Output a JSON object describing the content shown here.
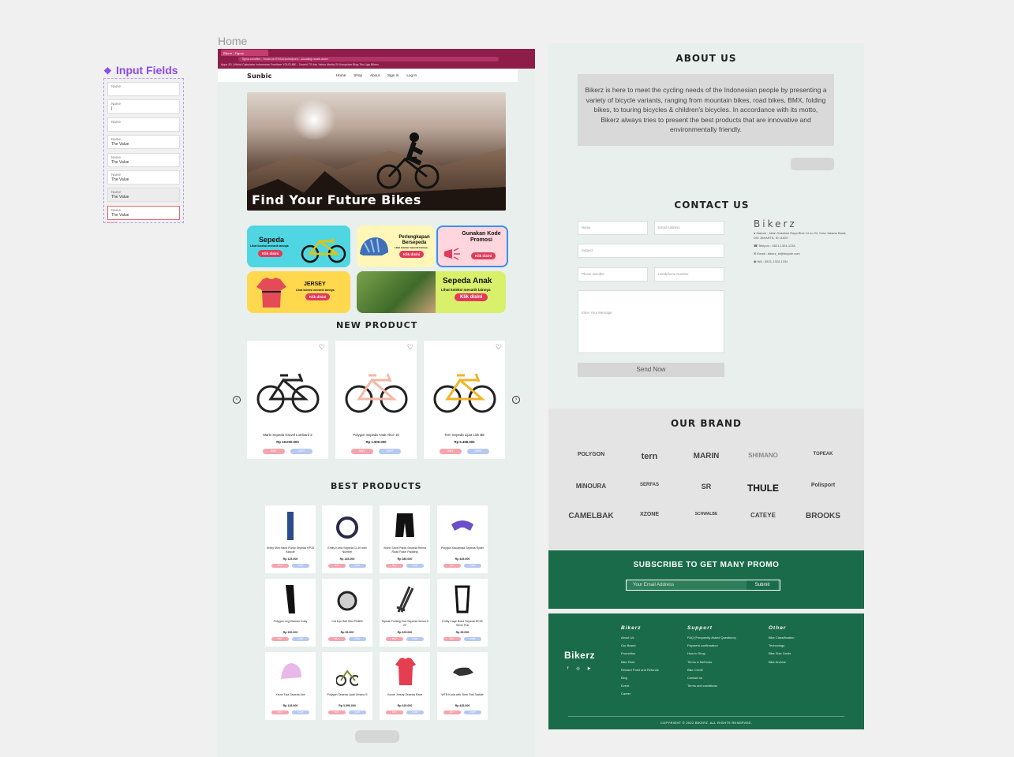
{
  "component_panel": {
    "title": "Input Fields",
    "fields": [
      {
        "label": "Name",
        "value": "",
        "state": "default"
      },
      {
        "label": "Name",
        "value": "|",
        "state": "focus"
      },
      {
        "label": "Name",
        "value": "",
        "state": "default"
      },
      {
        "label": "Name",
        "value": "The Value",
        "state": "filled"
      },
      {
        "label": "Name",
        "value": "The Value",
        "state": "filled"
      },
      {
        "label": "Name",
        "value": "The Value",
        "state": "filled"
      },
      {
        "label": "Name",
        "value": "The Value",
        "state": "disabled"
      },
      {
        "label": "Name",
        "value": "The Value",
        "state": "error"
      }
    ],
    "error_text": "Error text"
  },
  "home": {
    "frame_label": "Home",
    "browser": {
      "tab": "Bikerz - Figma",
      "url": "figma.com/file/...?node-id=0%3A1&viewport=...&scaling=scale-down",
      "bookmarks": "Apps   2D | Weird Calculator   Indonesian Furniture   YOUTUBE - Toweld   TS   Ask Yahoo   Media   20 Kumpulan Blog   Tim Liga Bikerz"
    },
    "nav": {
      "logo": "Sunbic",
      "links": [
        "Home",
        "Shop",
        "About",
        "Sign In",
        "Log In"
      ]
    },
    "hero_title": "Find Your Future Bikes",
    "categories": {
      "sepeda": {
        "title": "Sepeda",
        "sub": "Lihat koleksi menarik lainnya",
        "btn": "Klik disini"
      },
      "perlengkapan": {
        "title": "Perlengkapan Bersepeda",
        "sub": "Lihat koleksi menarik lainnya",
        "btn": "Klik disini"
      },
      "kode": {
        "title": "Gunakan Kode Promosi",
        "btn": "Klik disini"
      },
      "jersey": {
        "title": "JERSEY",
        "sub": "Lihat koleksi menarik lainnya",
        "btn": "Klik disini"
      },
      "anak": {
        "title": "Sepeda Anak",
        "sub": "Lihat koleksi menarik lainnya",
        "btn": "Klik disini"
      }
    },
    "new_product_title": "NEW PRODUCT",
    "new_products": [
      {
        "name": "Marin Sepeda Gravel Lombard 2",
        "price": "Rp 19.000.000",
        "buy": "BUY",
        "cart": "CART"
      },
      {
        "name": "Polygon Sepeda Anak Alice 16",
        "price": "Rp 1.900.000",
        "buy": "BUY",
        "cart": "CART"
      },
      {
        "name": "Tern Sepeda Lipat Link B8",
        "price": "Rp 5.458.000",
        "buy": "BUY",
        "cart": "CART"
      }
    ],
    "best_products_title": "BEST PRODUCTS",
    "best_products": [
      {
        "name": "Entity Mini Hand Pump Sepeda HP15 Bicycle",
        "price": "Rp 125.000",
        "buy": "BUY",
        "cart": "CART"
      },
      {
        "name": "Entity Kunci Sepeda CL30 with Number",
        "price": "Rp 145.000",
        "buy": "BUY",
        "cart": "CART"
      },
      {
        "name": "Xtone Short Pants Sepeda Renva Road Foam Padding",
        "price": "Rp 380.000",
        "buy": "BUY",
        "cart": "CART"
      },
      {
        "name": "Polygon Kacamata Sepeda Ryder",
        "price": "Rp 445.000",
        "buy": "BUY",
        "cart": "CART"
      },
      {
        "name": "Polygon Leg Warmer Eddy",
        "price": "Rp 150.000",
        "buy": "BUY",
        "cart": "CART"
      },
      {
        "name": "Cat Eye Bell Mini PD800",
        "price": "Rp 95.000",
        "buy": "BUY",
        "cart": "CART"
      },
      {
        "name": "Topeak Folding Tool Sepeda Hexus II 29",
        "price": "Rp 325.000",
        "buy": "BUY",
        "cart": "CART"
      },
      {
        "name": "Entity Cage Botol Sepeda BC45 Silver Pull",
        "price": "Rp 95.000",
        "buy": "BUY",
        "cart": "CART"
      },
      {
        "name": "Xtone Topi Sepeda Ace",
        "price": "Rp 145.000",
        "buy": "BUY",
        "cart": "CART"
      },
      {
        "name": "Polygon Sepeda Lipat Urbano 5",
        "price": "Rp 3.590.000",
        "buy": "BUY",
        "cart": "CART"
      },
      {
        "name": "Xzone Jersey Sepeda Race",
        "price": "Rp 625.000",
        "buy": "BUY",
        "cart": "CART"
      },
      {
        "name": "WTB Koda with Steel Rail Saddle",
        "price": "Rp 435.000",
        "buy": "BUY",
        "cart": "CART"
      }
    ]
  },
  "about": {
    "title": "ABOUT US",
    "text": "Bikerz is here to meet the cycling needs of the Indonesian people by presenting a variety of bicycle variants, ranging from mountain bikes, road bikes, BMX, folding bikes, to touring bicycles & children's bicycles. In accordance with its motto, Bikerz always tries to present the best products that are innovative and environmentally friendly."
  },
  "contact": {
    "title": "CONTACT US",
    "placeholders": {
      "name": "Name",
      "email": "Email Address",
      "subject": "Subject",
      "phone": "Phone Number",
      "handphone": "Handphone Number",
      "message": "Enter Your Message"
    },
    "send": "Send Now",
    "info": {
      "brand": "Bikerz",
      "address": "Alamat : Jalan Sukaluni Raya Blok 14 no 24, Kota Jakarta Barat, DKI JAKARTA, ID 11820",
      "phone": "Telepon : 0821-1324-1234",
      "email": "Email : bikerz_id@bicycle.com",
      "wa": "WA : 0821-1324-1234"
    }
  },
  "brands": {
    "title": "OUR BRAND",
    "list": [
      "POLYGON",
      "tern",
      "MARIN",
      "SHIMANO",
      "TOPEAK",
      "MINOURA",
      "SERFAS",
      "SR",
      "THULE",
      "Polisport",
      "CAMELBAK",
      "XZONE",
      "SCHWALBE",
      "CATEYE",
      "BROOKS"
    ]
  },
  "promo": {
    "title": "SUBSCRIBE TO GET MANY PROMO",
    "placeholder": "Your Email Address",
    "submit": "Submit"
  },
  "footer": {
    "brand": "Bikerz",
    "col1": {
      "title": "Bikerz",
      "items": [
        "About Us",
        "Our Brand",
        "Promotion",
        "Bike Rent",
        "Reward Point and Refunds",
        "Blog",
        "Event",
        "Career"
      ]
    },
    "col2": {
      "title": "Support",
      "items": [
        "FAQ (Frequently Asked Questions)",
        "Payment confirmation",
        "How to Shop",
        "Terms & Methods",
        "Bike Credit",
        "Contact us",
        "Terms and conditions"
      ]
    },
    "col3": {
      "title": "Other",
      "items": [
        "Bike Classification",
        "Technology",
        "Bike Size Guide",
        "Bike Archive"
      ]
    },
    "copyright": "COPYRIGHT © 2022 BIKERZ. ALL RIGHTS RESERVED."
  }
}
